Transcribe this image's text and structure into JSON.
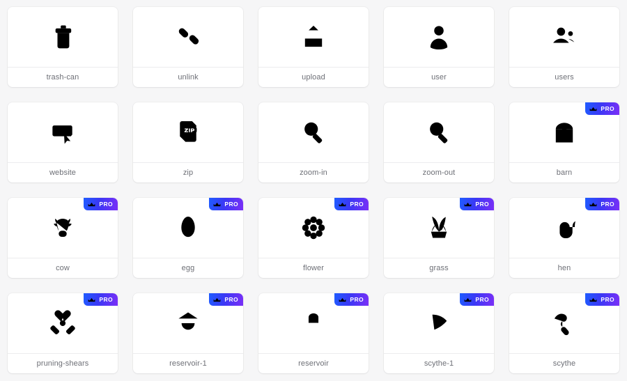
{
  "gallery": {
    "columns": 5,
    "rows": 4,
    "background_color": "#f6f6f7",
    "card_color": "#ffffff",
    "label_color": "#6d6f76",
    "icon_color": "#111111",
    "pro_badge": {
      "text": "PRO",
      "icon": "crown-icon",
      "gradient_from": "#1f5cff",
      "gradient_to": "#7b2ff7",
      "text_color": "#ffffff"
    },
    "items": [
      {
        "label": "trash-can",
        "icon": "trash-can-icon",
        "pro": false
      },
      {
        "label": "unlink",
        "icon": "unlink-icon",
        "pro": false
      },
      {
        "label": "upload",
        "icon": "upload-icon",
        "pro": false
      },
      {
        "label": "user",
        "icon": "user-icon",
        "pro": false
      },
      {
        "label": "users",
        "icon": "users-icon",
        "pro": false
      },
      {
        "label": "website",
        "icon": "website-icon",
        "pro": false
      },
      {
        "label": "zip",
        "icon": "zip-file-icon",
        "pro": false
      },
      {
        "label": "zoom-in",
        "icon": "zoom-in-icon",
        "pro": false
      },
      {
        "label": "zoom-out",
        "icon": "zoom-out-icon",
        "pro": false
      },
      {
        "label": "barn",
        "icon": "barn-icon",
        "pro": true
      },
      {
        "label": "cow",
        "icon": "cow-icon",
        "pro": true
      },
      {
        "label": "egg",
        "icon": "egg-icon",
        "pro": true
      },
      {
        "label": "flower",
        "icon": "flower-icon",
        "pro": true
      },
      {
        "label": "grass",
        "icon": "grass-icon",
        "pro": true
      },
      {
        "label": "hen",
        "icon": "hen-icon",
        "pro": true
      },
      {
        "label": "pruning-shears",
        "icon": "pruning-shears-icon",
        "pro": true
      },
      {
        "label": "reservoir-1",
        "icon": "reservoir-1-icon",
        "pro": true
      },
      {
        "label": "reservoir",
        "icon": "reservoir-icon",
        "pro": true
      },
      {
        "label": "scythe-1",
        "icon": "scythe-1-icon",
        "pro": true
      },
      {
        "label": "scythe",
        "icon": "scythe-icon",
        "pro": true
      }
    ]
  }
}
